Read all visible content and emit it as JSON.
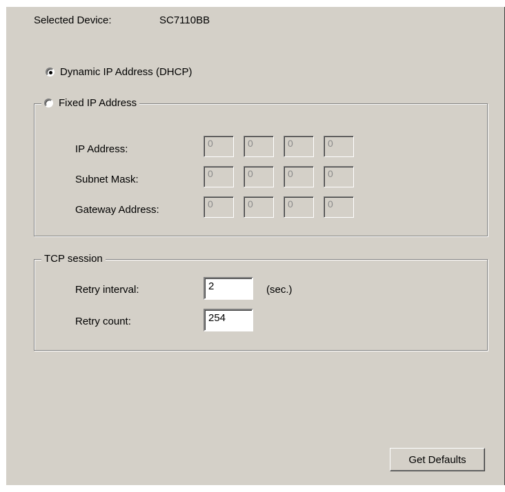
{
  "device": {
    "label": "Selected Device:",
    "value": "SC7110BB"
  },
  "dhcp": {
    "label": "Dynamic IP Address (DHCP)",
    "checked": true
  },
  "fixed": {
    "label": "Fixed IP Address",
    "checked": false,
    "rows": [
      {
        "label": "IP Address:",
        "octets": [
          "0",
          "0",
          "0",
          "0"
        ]
      },
      {
        "label": "Subnet Mask:",
        "octets": [
          "0",
          "0",
          "0",
          "0"
        ]
      },
      {
        "label": "Gateway Address:",
        "octets": [
          "0",
          "0",
          "0",
          "0"
        ]
      }
    ]
  },
  "tcp": {
    "title": "TCP session",
    "retry_interval": {
      "label": "Retry interval:",
      "value": "2",
      "unit": "(sec.)"
    },
    "retry_count": {
      "label": "Retry count:",
      "value": "254"
    }
  },
  "buttons": {
    "get_defaults": "Get Defaults"
  }
}
